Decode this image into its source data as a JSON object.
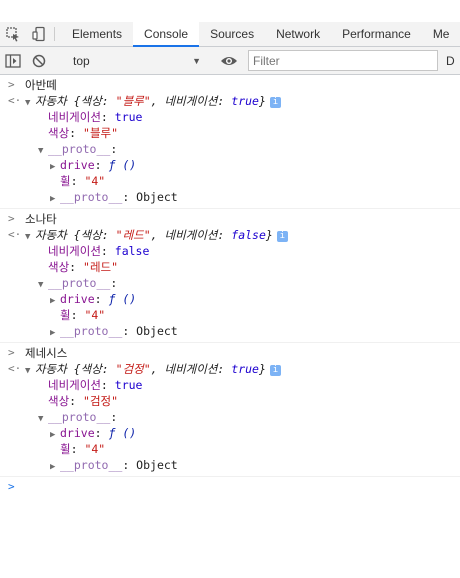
{
  "tabs": [
    {
      "label": "Elements",
      "active": false
    },
    {
      "label": "Console",
      "active": true
    },
    {
      "label": "Sources",
      "active": false
    },
    {
      "label": "Network",
      "active": false
    },
    {
      "label": "Performance",
      "active": false
    },
    {
      "label": "Me",
      "active": false
    }
  ],
  "toolbar": {
    "context": "top",
    "filter_placeholder": "Filter",
    "right_cut": "D"
  },
  "entries": [
    {
      "input": "아반떼",
      "class": "자동차",
      "color_key": "색상",
      "color_value": "\"블루\"",
      "nav_key": "네비게이션",
      "nav_value": "true",
      "proto_key": "__proto__",
      "drive_key": "drive",
      "drive_value": "ƒ ()",
      "wheel_key": "휠",
      "wheel_value": "\"4\"",
      "object_label": "Object"
    },
    {
      "input": "소나타",
      "class": "자동차",
      "color_key": "색상",
      "color_value": "\"레드\"",
      "nav_key": "네비게이션",
      "nav_value": "false",
      "proto_key": "__proto__",
      "drive_key": "drive",
      "drive_value": "ƒ ()",
      "wheel_key": "휠",
      "wheel_value": "\"4\"",
      "object_label": "Object"
    },
    {
      "input": "제네시스",
      "class": "자동차",
      "color_key": "색상",
      "color_value": "\"검정\"",
      "nav_key": "네비게이션",
      "nav_value": "true",
      "proto_key": "__proto__",
      "drive_key": "drive",
      "drive_value": "ƒ ()",
      "wheel_key": "휠",
      "wheel_value": "\"4\"",
      "object_label": "Object"
    }
  ],
  "symbols": {
    "input_prompt": ">",
    "result_marker": "<·",
    "expanded": "▼",
    "collapsed": "▶",
    "info": "i",
    "colon": ": ",
    "comma": ", ",
    "brace_open": " {",
    "brace_close": "}"
  }
}
